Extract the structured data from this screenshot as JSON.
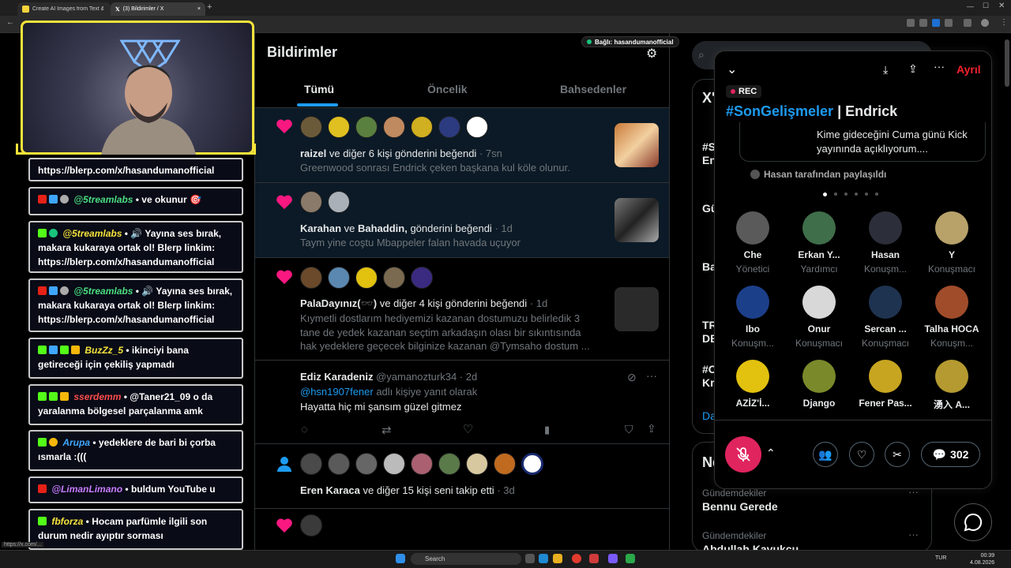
{
  "browser": {
    "tabs": [
      {
        "label": "Create AI Images from Text & I"
      },
      {
        "label": "(3) Bildirimler / X"
      }
    ],
    "status_url": "https://x.com/..."
  },
  "stream": {
    "connected_badge": "Bağlı: hasandumanofficial",
    "chat": [
      {
        "user": "",
        "text": "https://blerp.com/x/hasandumanofficial"
      },
      {
        "user": "@5treamlabs",
        "text": "ve okunur 🎯"
      },
      {
        "user": "@5treamlabs",
        "text": "🔊 Yayına ses bırak, makara kukaraya ortak ol! Blerp linkim: https://blerp.com/x/hasandumanofficial"
      },
      {
        "user": "@5treamlabs",
        "text": "🔊 Yayına ses bırak, makara kukaraya ortak ol! Blerp linkim: https://blerp.com/x/hasandumanofficial"
      },
      {
        "user": "BuzZz_5",
        "text": "ikinciyi bana getireceği için çekiliş yapmadı"
      },
      {
        "user": "sserdemm",
        "text": "@Taner21_09 o da yaralanma bölgesel parçalanma amk"
      },
      {
        "user": "Arupa",
        "text": "yedeklere de bari bi çorba ısmarla :((("
      },
      {
        "user": "@LimanLimano",
        "text": "buldum YouTube u"
      },
      {
        "user": "fbforza",
        "text": "Hocam parfümle ilgili son durum nedir ayıptır sorması"
      }
    ]
  },
  "notifications": {
    "title": "Bildirimler",
    "tabs": [
      "Tümü",
      "Öncelik",
      "Bahsedenler"
    ],
    "items": [
      {
        "who": "raizel",
        "rest": " ve diğer 6 kişi gönderini beğendi",
        "time": "· 7sn",
        "preview": "Greenwood sonrası Endrick çeken başkana kul köle olunur."
      },
      {
        "who": "Karahan",
        "mid": " ve ",
        "who2": "Bahaddin,",
        "rest": " gönderini beğendi",
        "time": "· 1d",
        "preview": "Taym yine coştu Mbappeler falan havada uçuyor"
      },
      {
        "who": "PalaDayınız(🕶️)",
        "rest": " ve diğer 4 kişi gönderini beğendi",
        "time": "· 1d",
        "preview": "Kıymetli dostlarım hediyemizi kazanan dostumuzu belirledik 3 tane de yedek kazanan seçtim arkadaşın olası bir sıkıntısında hak yedeklere geçecek bilginize kazanan @Tymsaho dostum ..."
      }
    ],
    "reply": {
      "name": "Ediz Karadeniz",
      "handle": "@yamanozturk34 · 2d",
      "context_prefix": "@hsn1907fener",
      "context_suffix": " adlı kişiye yanıt olarak",
      "text": "Hayatta hiç mi şansım güzel gitmez"
    },
    "follow": {
      "who": "Eren Karaca",
      "rest": " ve diğer 15 kişi seni takip etti",
      "time": "· 3d"
    }
  },
  "trends": {
    "items": [
      {
        "label": "Gündemdekiler",
        "name": "Bennu Gerede"
      },
      {
        "label": "Gündemdekiler",
        "name": "Abdullah Kavukçu"
      }
    ],
    "side_fragments": [
      "X'",
      "#S",
      "En",
      "Gü",
      "Ba",
      "TR",
      "DE",
      "#C",
      "Kri",
      "Da",
      "Ne"
    ]
  },
  "space": {
    "leave": "Ayrıl",
    "rec": "REC",
    "title_tag": "#SonGelişmeler",
    "title_rest": " | Endrick",
    "pinned_text": "Kime gideceğini Cuma günü Kick yayınında açıklıyorum....",
    "shared_by": "Hasan tarafından paylaşıldı",
    "participants": [
      {
        "name": "Che",
        "role": "Yönetici",
        "color": "#5a5a5a"
      },
      {
        "name": "Erkan Y...",
        "role": "Yardımcı",
        "color": "#3f6e4a"
      },
      {
        "name": "Hasan",
        "role": "Konuşm...",
        "color": "#2c2f3a"
      },
      {
        "name": "Y",
        "role": "Konuşmacı",
        "color": "#b8a26a"
      },
      {
        "name": "Ibo",
        "role": "Konuşm...",
        "color": "#1c3f8a"
      },
      {
        "name": "Onur",
        "role": "Konuşmacı",
        "color": "#d8d8d8"
      },
      {
        "name": "Sercan ...",
        "role": "Konuşmacı",
        "color": "#1e3350"
      },
      {
        "name": "Talha HOCA",
        "role": "Konuşm...",
        "color": "#a04c2a"
      },
      {
        "name": "AZİZ'İ...",
        "role": "",
        "color": "#e2c10f"
      },
      {
        "name": "Django",
        "role": "",
        "color": "#7a8a2a"
      },
      {
        "name": "Fener Pas...",
        "role": "",
        "color": "#c8a520"
      },
      {
        "name": "湧入 A...",
        "role": "",
        "color": "#b49a30"
      }
    ],
    "comment_count": "302"
  },
  "taskbar": {
    "search": "Search",
    "time": "00:39",
    "date": "4.08.2026",
    "lang": "TUR"
  },
  "colors": {
    "like": "#f91880",
    "blue": "#1d9bf0",
    "rec": "#e0245e",
    "leave": "#f4212e",
    "webcam_frame": "#f5e33a"
  }
}
